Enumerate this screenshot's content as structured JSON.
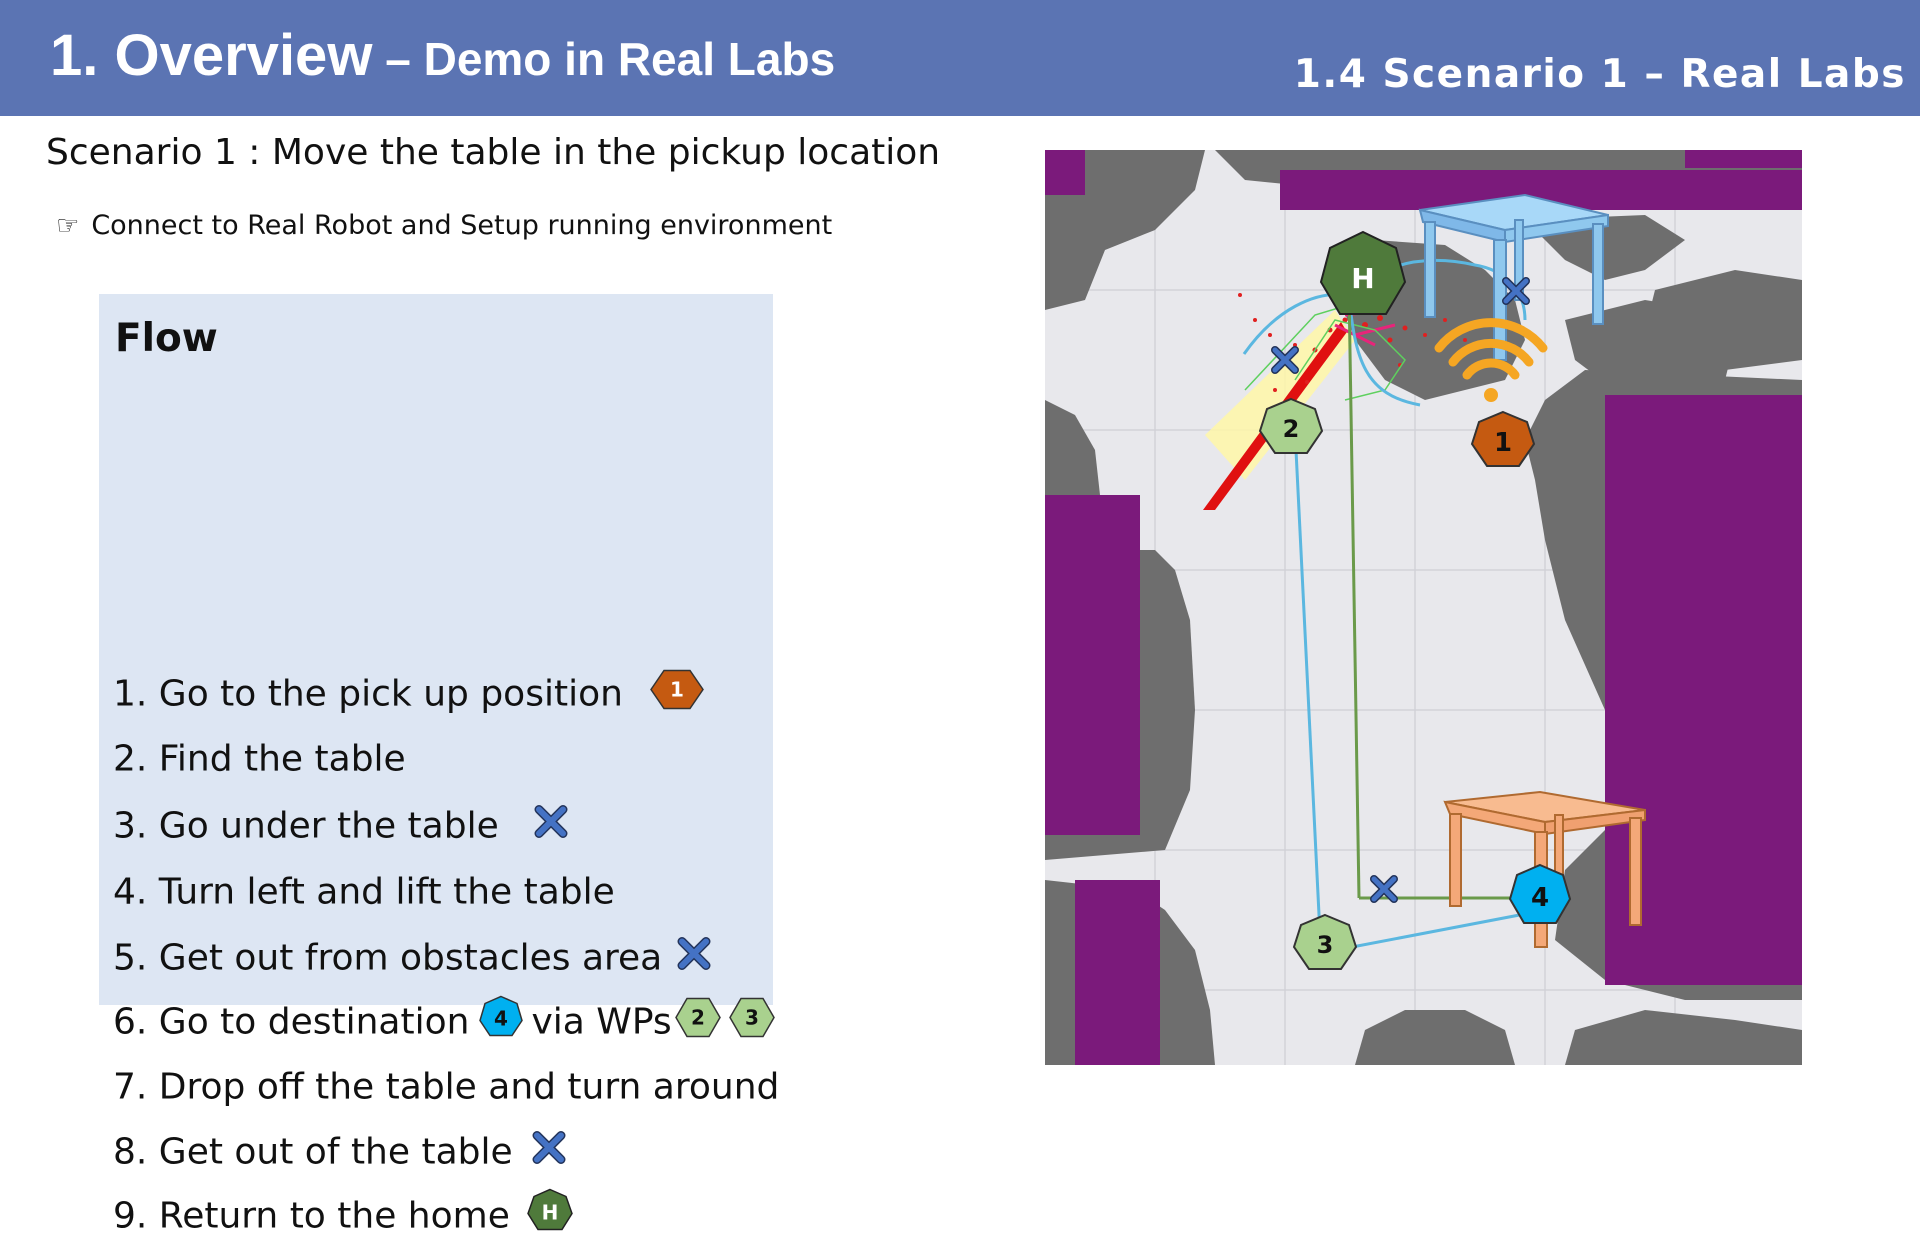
{
  "header": {
    "title_main": "1. Overview",
    "title_dash": " – ",
    "title_sub": "Demo in Real Labs",
    "section": "1.4 Scenario 1 – Real Labs"
  },
  "scenario_line": "Scenario 1 : Move the table in the pickup location",
  "connect": {
    "icon": "pointing-hand-icon",
    "text": "Connect to Real Robot and Setup running environment"
  },
  "flow": {
    "title": "Flow",
    "steps": [
      {
        "text": "1. Go to the pick up position"
      },
      {
        "text": "2. Find the table"
      },
      {
        "text": "3. Go under the table"
      },
      {
        "text": "4. Turn left and lift the table"
      },
      {
        "text": "5. Get out from obstacles area"
      },
      {
        "text": "6. Go to destination",
        "text2": "via WPs"
      },
      {
        "text": "7. Drop off the table and turn around"
      },
      {
        "text": "8. Get out of the table"
      },
      {
        "text": "9. Return to the home"
      }
    ]
  },
  "markers": {
    "home": "H",
    "pickup": "1",
    "wp2": "2",
    "wp3": "3",
    "destination": "4"
  },
  "colors": {
    "header": "#5b74b3",
    "flow_box": "#dde6f3",
    "home": "#4f7a3b",
    "pickup": "#c55a11",
    "waypoint": "#a9d18e",
    "destination": "#00b0f0",
    "cross": "#4472c4",
    "map_free": "#e8e8ec",
    "map_wall": "#6e6e6e",
    "map_obstacle": "#7b1a7b",
    "table_blue": "#8fc8ee",
    "table_orange": "#f4a878",
    "wifi": "#f5a623"
  }
}
